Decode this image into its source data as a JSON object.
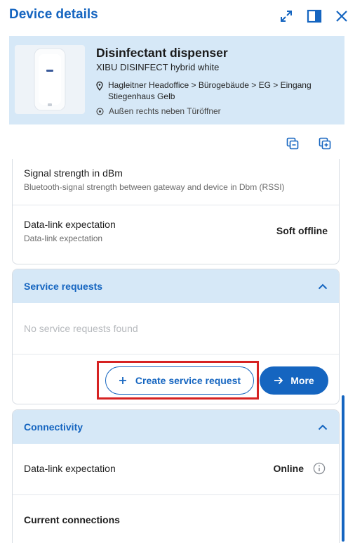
{
  "header": {
    "title": "Device details"
  },
  "device": {
    "name": "Disinfectant dispenser",
    "model": "XIBU DISINFECT hybrid white",
    "location": "Hagleitner Headoffice > Bürogebäude > EG > Eingang Stiegenhaus Gelb",
    "position_note": "Außen rechts neben Türöffner"
  },
  "properties": {
    "signal": {
      "title": "Signal strength in dBm",
      "subtitle": "Bluetooth-signal strength between gateway and device in Dbm (RSSI)"
    },
    "datalink": {
      "title": "Data-link expectation",
      "subtitle": "Data-link expectation",
      "value": "Soft offline"
    }
  },
  "service_requests": {
    "title": "Service requests",
    "empty_text": "No service requests found",
    "create_label": "Create service request",
    "more_label": "More"
  },
  "connectivity": {
    "title": "Connectivity",
    "datalink_label": "Data-link expectation",
    "datalink_value": "Online",
    "current_connections_label": "Current connections"
  },
  "colors": {
    "primary": "#1565c0",
    "card_background": "#d6e8f7",
    "highlight": "#d62222"
  },
  "icons": [
    "expand-icon",
    "side-panel-icon",
    "close-icon",
    "location-pin-icon",
    "target-icon",
    "copy-icon",
    "copy-add-icon",
    "chevron-up-icon",
    "plus-icon",
    "arrow-right-icon",
    "info-icon"
  ]
}
